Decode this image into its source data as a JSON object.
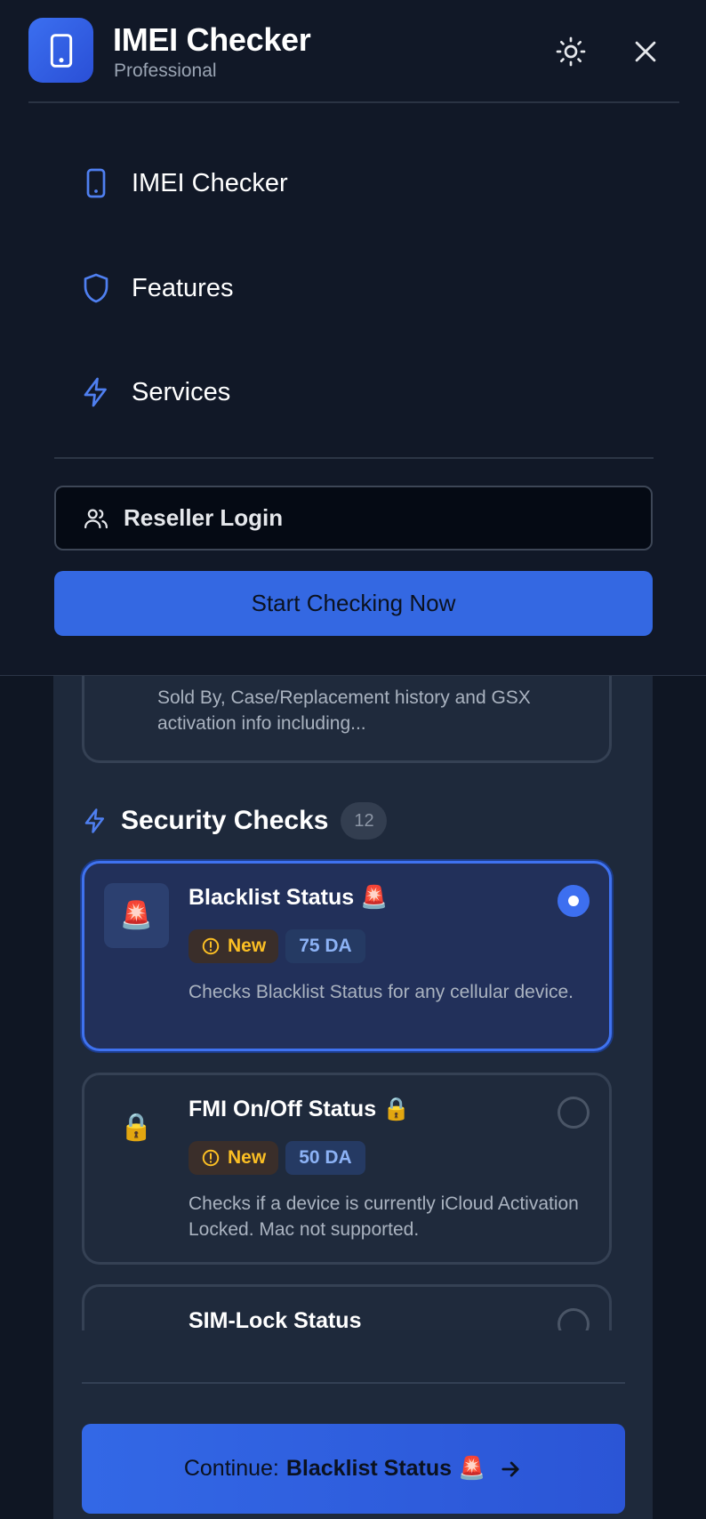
{
  "app": {
    "title": "IMEI Checker",
    "subtitle": "Professional",
    "accent_color": "#3468e2"
  },
  "header_icons": {
    "theme": "sun-icon",
    "close": "close-icon",
    "logo": "smartphone-icon"
  },
  "nav": {
    "items": [
      {
        "label": "IMEI Checker",
        "icon": "smartphone-icon"
      },
      {
        "label": "Features",
        "icon": "shield-icon"
      },
      {
        "label": "Services",
        "icon": "lightning-icon"
      }
    ],
    "reseller_label": "Reseller Login",
    "cta_label": "Start Checking Now"
  },
  "page": {
    "previous_card_desc": "Sold By, Case/Replacement history and GSX activation info including...",
    "section": {
      "title": "Security Checks",
      "count": "12",
      "icon": "lightning-icon"
    },
    "services": [
      {
        "title": "Blacklist Status 🚨",
        "emoji": "🚨",
        "badge": "New",
        "price": "75 DA",
        "description": "Checks Blacklist Status for any cellular device.",
        "selected": true
      },
      {
        "title": "FMI On/Off Status 🔒",
        "emoji": "🔒",
        "badge": "New",
        "price": "50 DA",
        "description": "Checks if a device is currently iCloud Activation Locked. Mac not supported.",
        "selected": false
      },
      {
        "title": "SIM-Lock Status",
        "emoji": "",
        "badge": "",
        "price": "",
        "description": "",
        "selected": false
      }
    ],
    "continue": {
      "prefix": "Continue:",
      "service": "Blacklist Status 🚨"
    }
  }
}
